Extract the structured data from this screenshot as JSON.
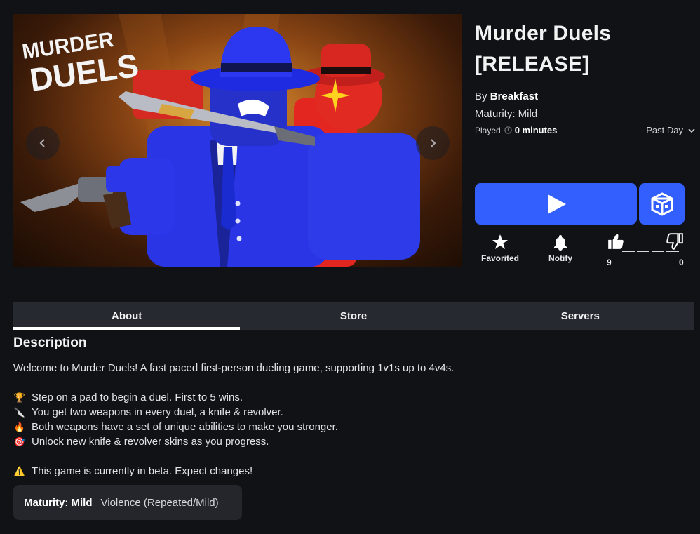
{
  "game": {
    "title_line1": "Murder Duels",
    "title_line2": "[RELEASE]",
    "by_prefix": "By",
    "creator": "Breakfast",
    "maturity": "Maturity: Mild",
    "played_label": "Played",
    "played_value": "0 minutes",
    "period": "Past Day"
  },
  "hero": {
    "logo_line1": "MURDER",
    "logo_line2": "DUELS",
    "prev_icon": "chevron-left-icon",
    "next_icon": "chevron-right-icon"
  },
  "actions": {
    "play_icon": "play-icon",
    "avatar_icon": "cube-icon",
    "favorite_label": "Favorited",
    "notify_label": "Notify",
    "upvotes": "9",
    "downvotes": "0"
  },
  "tabs": [
    "About",
    "Store",
    "Servers"
  ],
  "description": {
    "heading": "Description",
    "intro": "Welcome to Murder Duels! A fast paced first-person dueling game, supporting 1v1s up to 4v4s.",
    "bullets": [
      {
        "emoji": "🏆",
        "text": "Step on a pad to begin a duel. First to 5 wins."
      },
      {
        "emoji": "🔪",
        "text": "You get two weapons in every duel, a knife & revolver."
      },
      {
        "emoji": "🔥",
        "text": "Both weapons have a set of unique abilities to make you stronger."
      },
      {
        "emoji": "🎯",
        "text": "Unlock new knife & revolver skins as you progress."
      }
    ],
    "warning_emoji": "⚠️",
    "warning": "This game is currently in beta. Expect changes!"
  },
  "maturity_box": {
    "label": "Maturity: Mild",
    "value": "Violence (Repeated/Mild)"
  },
  "colors": {
    "background": "#111216",
    "accent_blue": "#335fff",
    "tab_bar": "#272930"
  }
}
